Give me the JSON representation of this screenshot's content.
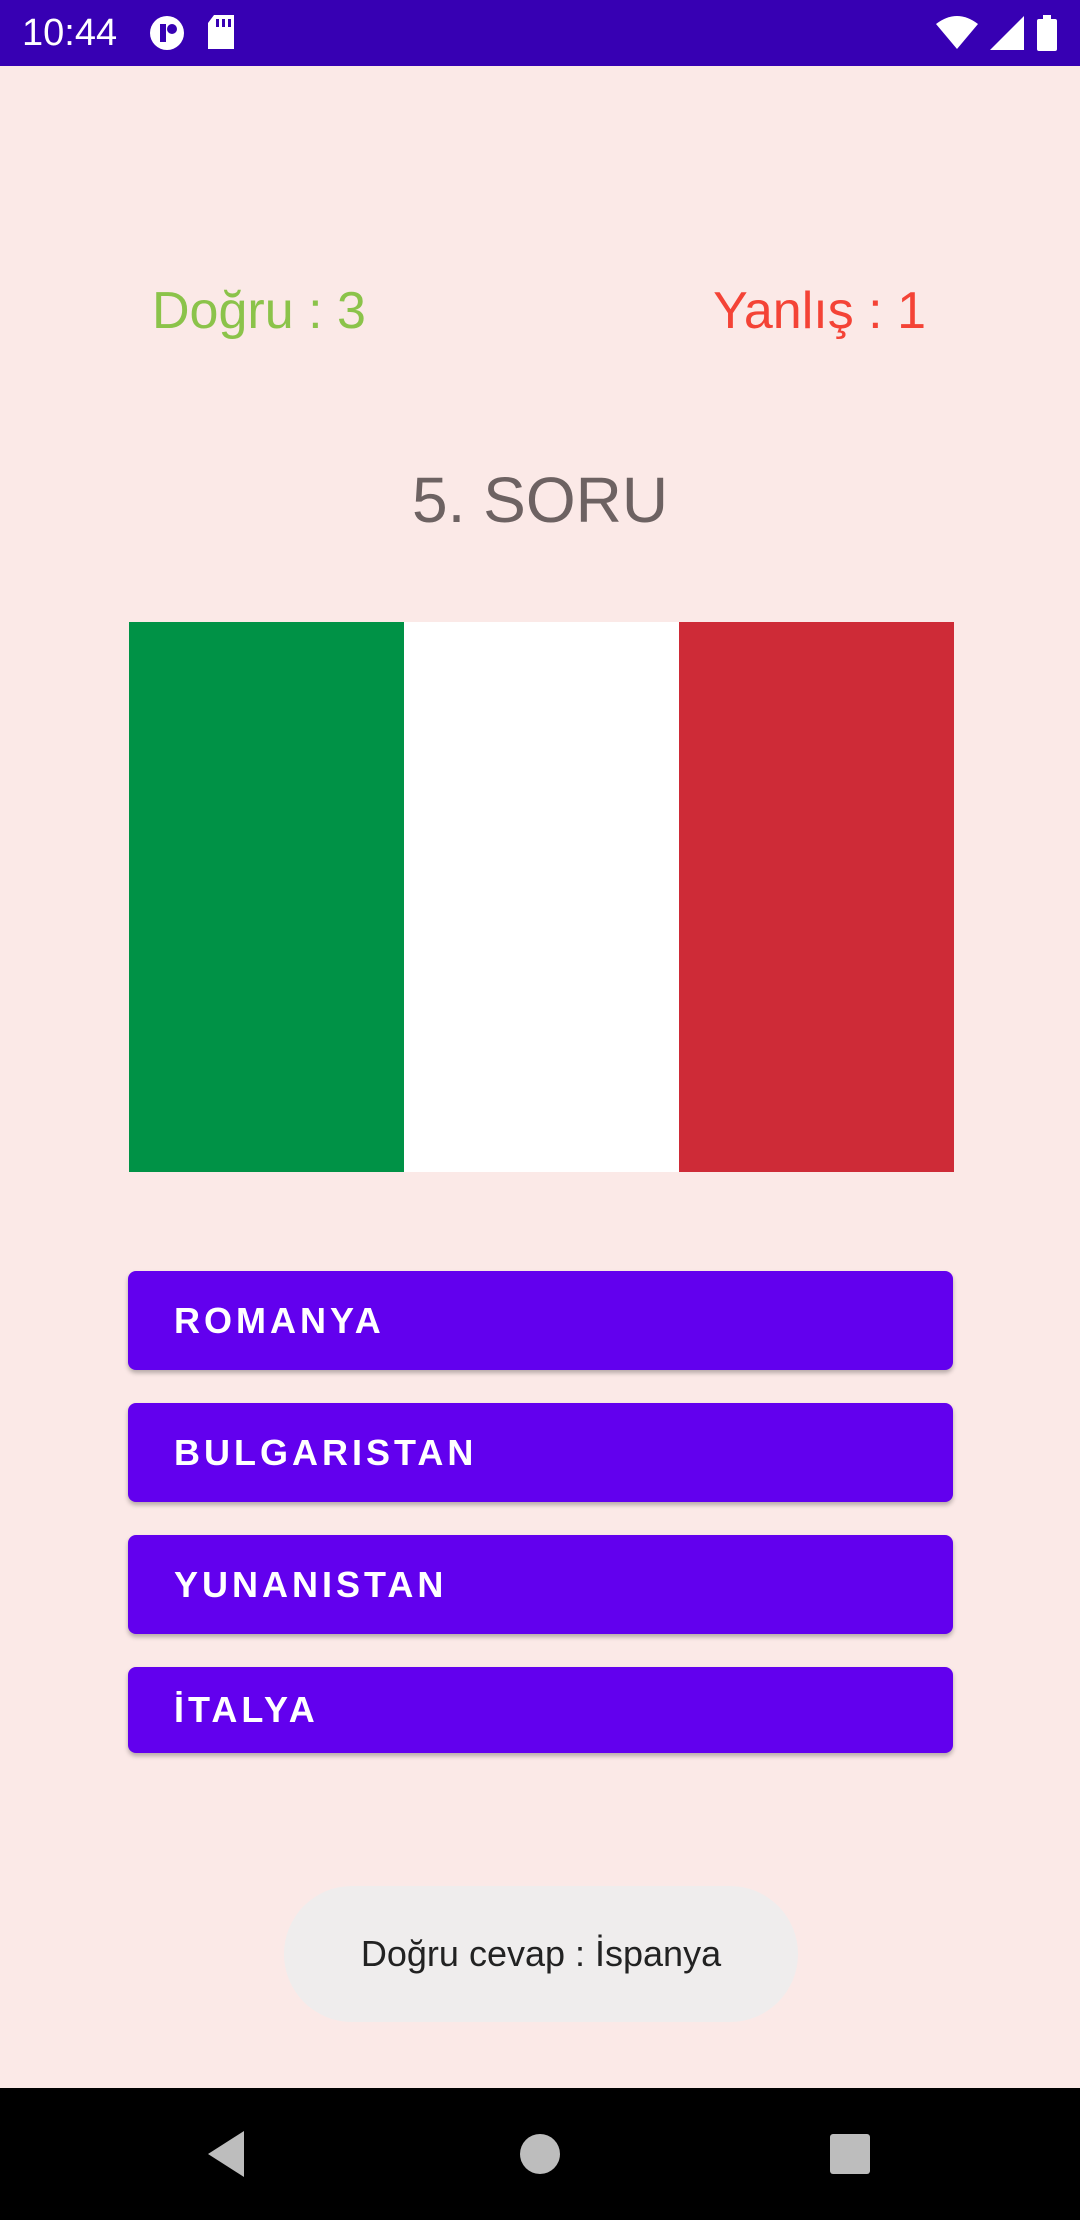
{
  "status_bar": {
    "time": "10:44",
    "left_icons": [
      "notification-app-icon",
      "sd-card-icon"
    ],
    "right_icons": [
      "wifi-icon",
      "signal-icon",
      "battery-icon"
    ],
    "background": "#3700B3"
  },
  "score": {
    "correct_label": "Doğru : 3",
    "wrong_label": "Yanlış : 1",
    "correct_color": "#8BC34A",
    "wrong_color": "#F44336"
  },
  "question": {
    "number_label": "5. SORU",
    "flag_image": {
      "icon": "flag-of-italy",
      "stripes": [
        "#009246",
        "#FFFFFF",
        "#CE2B37"
      ]
    }
  },
  "answers": [
    {
      "label": "ROMANYA"
    },
    {
      "label": "BULGARISTAN"
    },
    {
      "label": "YUNANISTAN"
    },
    {
      "label": "İTALYA"
    }
  ],
  "button_color": "#6200EE",
  "toast": {
    "message": "Doğru cevap : İspanya"
  },
  "nav_bar": {
    "buttons": [
      "back-icon",
      "home-icon",
      "recents-icon"
    ]
  }
}
